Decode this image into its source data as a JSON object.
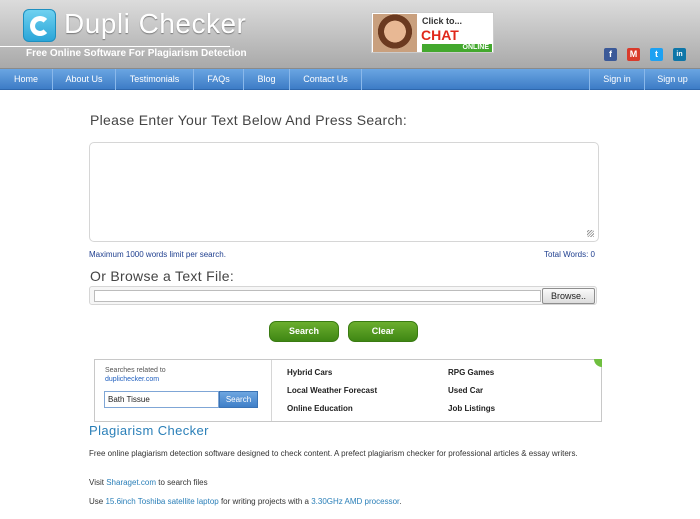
{
  "brand": {
    "name": "Dupli Checker",
    "tagline": "Free Online Software For Plagiarism Detection"
  },
  "chat_banner": {
    "click_text": "Click to...",
    "live_text": "CHAT LIVE",
    "online_text": "ONLINE"
  },
  "social": [
    {
      "name": "facebook-icon",
      "glyph": "f",
      "color": "#3b5998"
    },
    {
      "name": "gmail-icon",
      "glyph": "M",
      "color": "#d93a2b"
    },
    {
      "name": "twitter-icon",
      "glyph": "t",
      "color": "#1da1f2"
    },
    {
      "name": "linkedin-icon",
      "glyph": "in",
      "color": "#0e76a8"
    }
  ],
  "nav": {
    "home": "Home",
    "about": "About Us",
    "testimonials": "Testimonials",
    "faqs": "FAQs",
    "blog": "Blog",
    "contact": "Contact Us",
    "signin": "Sign in",
    "signup": "Sign up"
  },
  "main": {
    "heading": "Please Enter Your Text Below And Press Search:",
    "textarea_value": "",
    "limit_note": "Maximum 1000 words limit per search.",
    "total_words": "Total Words: 0",
    "browse_heading": "Or Browse a Text File:",
    "browse_button": "Browse..",
    "search_button": "Search",
    "clear_button": "Clear"
  },
  "ad": {
    "related_label": "Searches related to",
    "related_domain": "duplichecker.com",
    "search_value": "Bath Tissue",
    "search_button": "Search",
    "links": [
      "Hybrid Cars",
      "RPG Games",
      "Local Weather Forecast",
      "Used Car",
      "Online Education",
      "Job Listings"
    ]
  },
  "info": {
    "title": "Plagiarism Checker",
    "description": "Free online plagiarism detection software designed to check content. A prefect plagiarism checker for professional articles & essay writers.",
    "visit_prefix": "Visit ",
    "visit_link": "Sharaget.com",
    "visit_suffix": " to search files",
    "use_prefix": "Use ",
    "use_link1": "15.6inch Toshiba satellite laptop",
    "use_middle": " for writing projects with a ",
    "use_link2": "3.30GHz AMD processor",
    "use_suffix": "."
  },
  "colors": {
    "nav_blue": "#4a8ad2",
    "button_green": "#4f961f",
    "link_blue": "#2a7fb8"
  }
}
